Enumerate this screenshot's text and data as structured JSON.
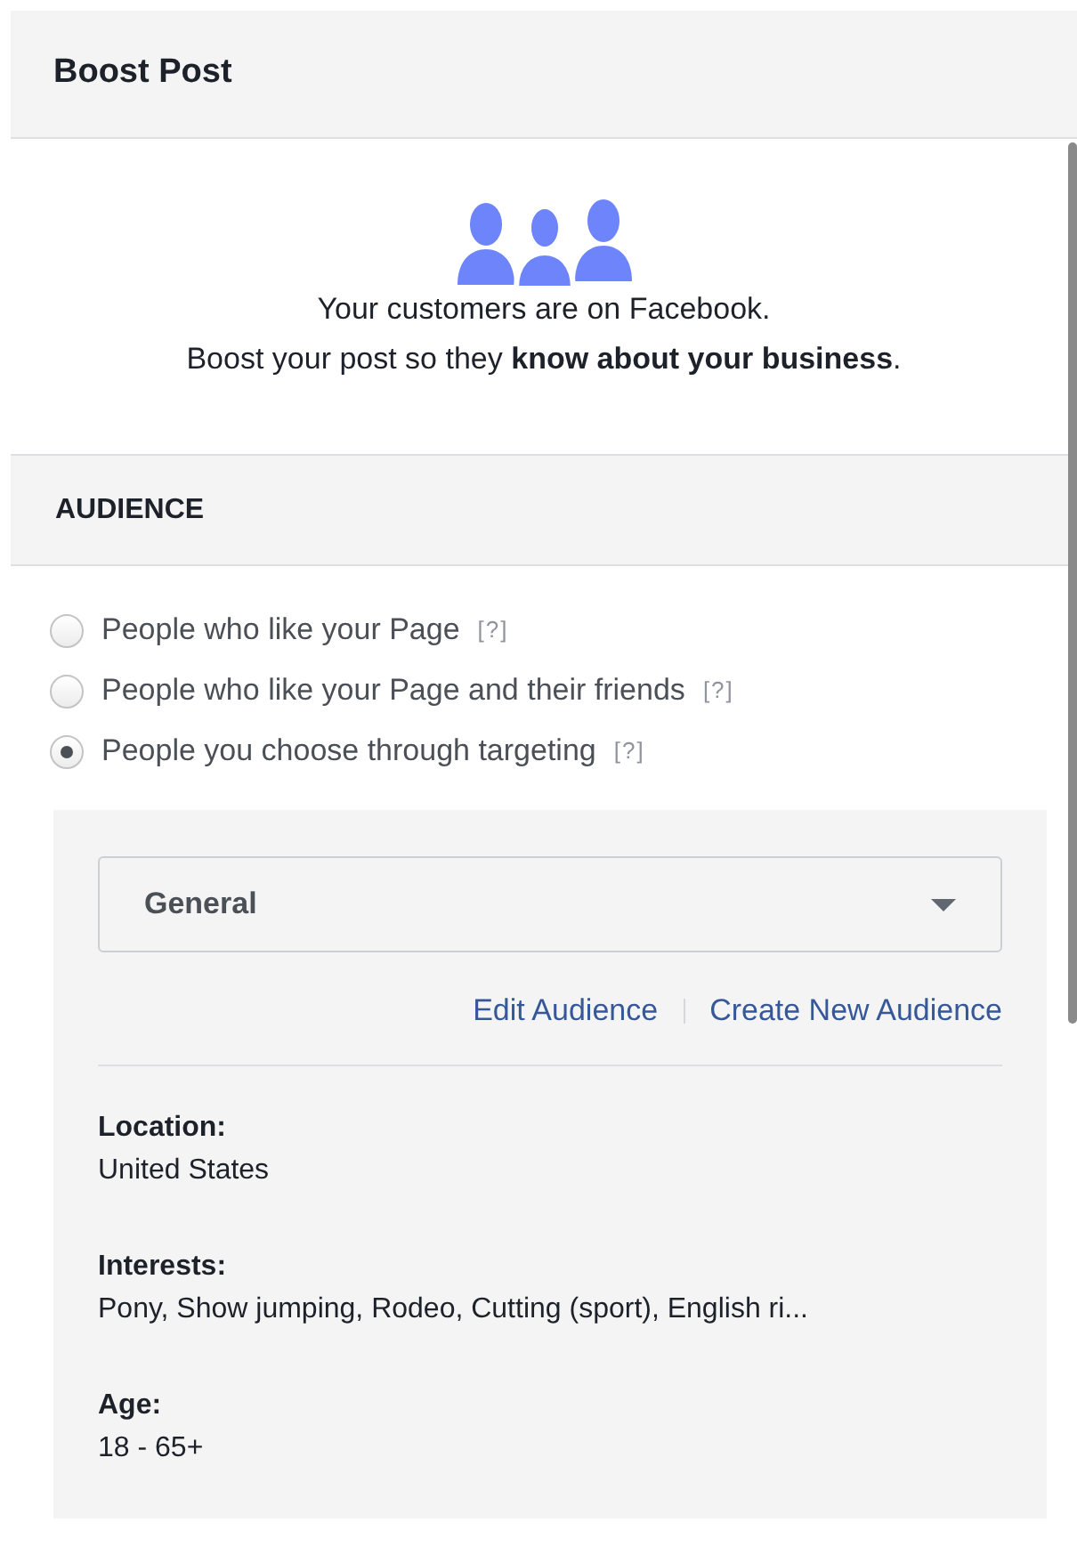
{
  "header": {
    "title": "Boost Post"
  },
  "intro": {
    "line_1": "Your customers are on Facebook.",
    "line_2": "Boost your post so they **know about your business**."
  },
  "audience": {
    "title": "AUDIENCE",
    "options": [
      {
        "label": "People who like your Page",
        "help": "[?]",
        "selected": false
      },
      {
        "label": "People who like your Page and their friends",
        "help": "[?]",
        "selected": false
      },
      {
        "label": "People you choose through targeting",
        "help": "[?]",
        "selected": true
      }
    ],
    "targeting": {
      "dropdown": {
        "value": "General"
      },
      "links": [
        "Edit Audience",
        "Create New Audience"
      ],
      "details": [
        {
          "label": "Location:",
          "value": "United States"
        },
        {
          "label": "Interests:",
          "value": "Pony, Show jumping, Rodeo, Cutting (sport), English ri..."
        },
        {
          "label": "Age:",
          "value": "18 - 65+"
        }
      ]
    }
  }
}
